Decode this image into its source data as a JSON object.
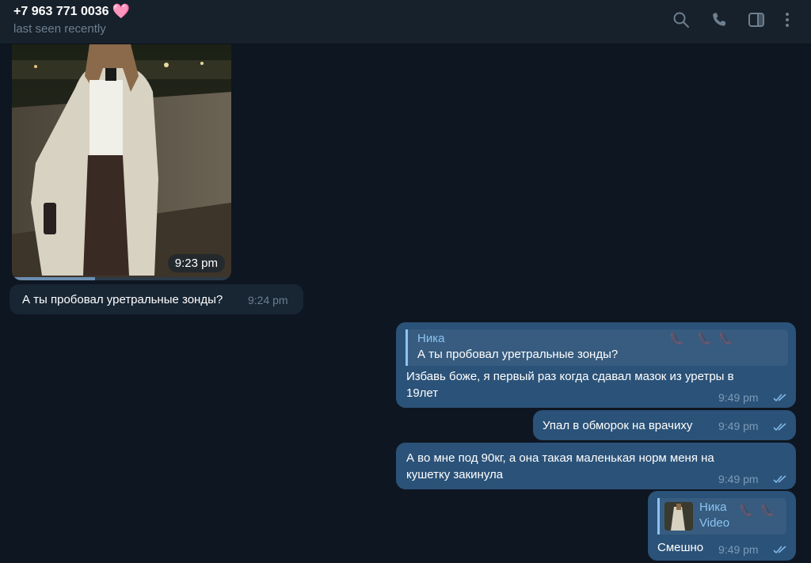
{
  "header": {
    "title": "+7 963 771 0036",
    "heart": "🩷",
    "status": "last seen recently"
  },
  "colors": {
    "background": "#0e1621",
    "header": "#17212b",
    "incoming_bubble": "#182533",
    "outgoing_bubble": "#2b5278",
    "accent": "#8cc3f2"
  },
  "icons": [
    "search-icon",
    "phone-icon",
    "sidebar-toggle-icon",
    "more-vertical-icon"
  ],
  "messages": {
    "video": {
      "time": "9:23 pm"
    },
    "m1": {
      "text": "А ты пробовал уретральные зонды?",
      "time": "9:24 pm"
    },
    "m2": {
      "reply_name": "Ника",
      "reply_text": "А ты пробовал уретральные зонды?",
      "text_line1": "Избавь боже, я первый раз когда сдавал мазок из уретры в",
      "text_line2": "19лет",
      "time": "9:49 pm"
    },
    "m3": {
      "text": "Упал в обморок на врачиху",
      "time": "9:49 pm"
    },
    "m4": {
      "text_line1": "А во мне под 90кг, а она такая маленькая норм меня на",
      "text_line2": "кушетку закинула",
      "time": "9:49 pm"
    },
    "m5": {
      "reply_name": "Ника",
      "reply_sub": "Video",
      "text": "Смешно",
      "time": "9:49 pm"
    }
  }
}
